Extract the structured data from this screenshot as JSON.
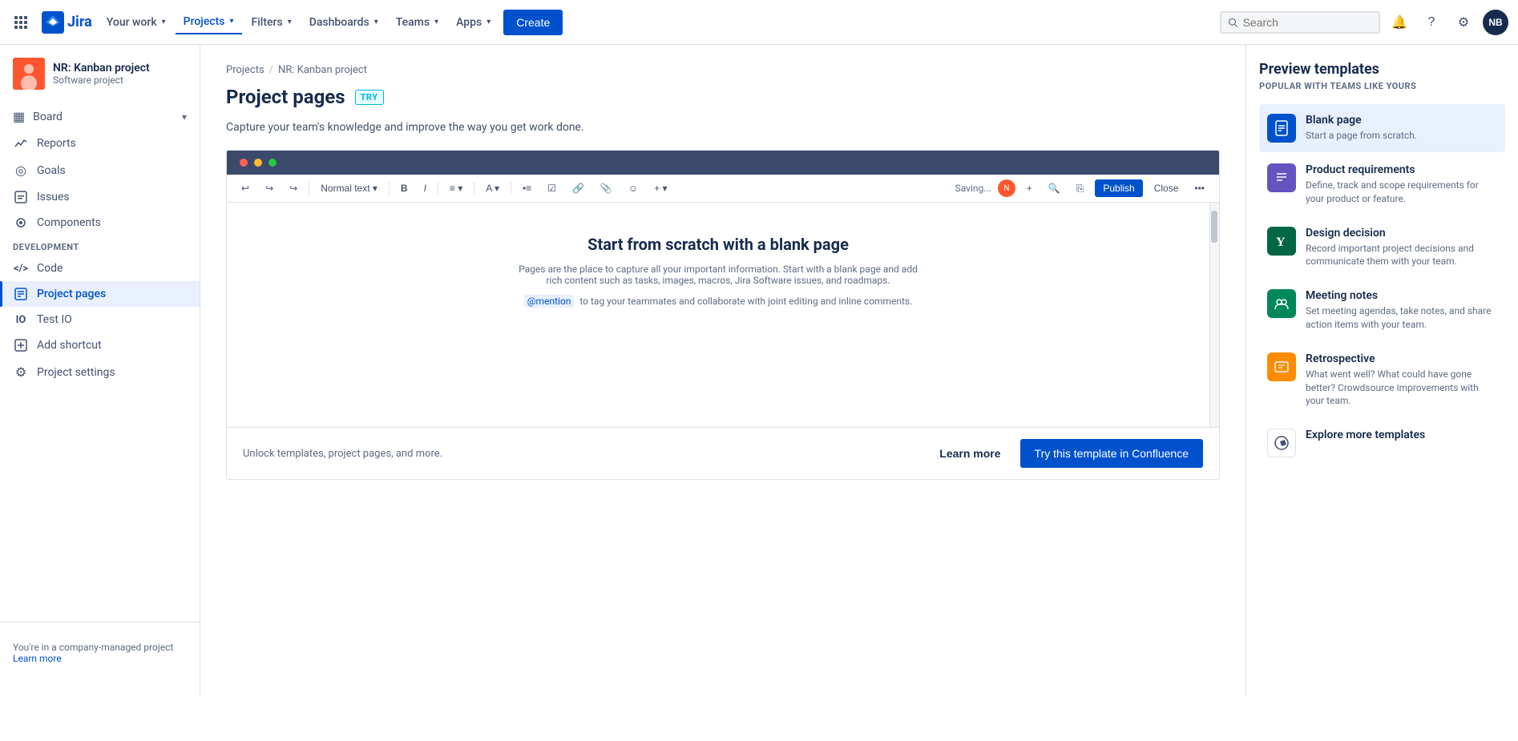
{
  "nav": {
    "your_work": "Your work",
    "projects": "Projects",
    "filters": "Filters",
    "dashboards": "Dashboards",
    "teams": "Teams",
    "apps": "Apps",
    "create": "Create",
    "search_placeholder": "Search",
    "avatar_initials": "NB"
  },
  "sidebar": {
    "project_name": "NR: Kanban project",
    "project_type": "Software project",
    "board_label": "Board",
    "items": [
      {
        "id": "reports",
        "label": "Reports",
        "icon": "📈"
      },
      {
        "id": "goals",
        "label": "Goals",
        "icon": "◎"
      },
      {
        "id": "issues",
        "label": "Issues",
        "icon": "▪"
      },
      {
        "id": "components",
        "label": "Components",
        "icon": "⊙"
      }
    ],
    "dev_section": "DEVELOPMENT",
    "dev_items": [
      {
        "id": "code",
        "label": "Code",
        "icon": "<>"
      }
    ],
    "project_pages_label": "Project pages",
    "test_io_label": "Test IO",
    "add_shortcut_label": "Add shortcut",
    "project_settings_label": "Project settings",
    "company_managed": "You're in a company-managed project",
    "learn_more": "Learn more"
  },
  "breadcrumb": {
    "projects": "Projects",
    "project_name": "NR: Kanban project"
  },
  "main": {
    "page_title": "Project pages",
    "try_badge": "TRY",
    "description": "Capture your team's knowledge and improve the way you get work done.",
    "editor": {
      "toolbar_items": [
        "Normal text",
        "B",
        "I",
        "≡",
        "A",
        "• ≡",
        "☑",
        "🔗",
        "📎",
        "☺",
        "+ ▾"
      ],
      "saving_text": "Saving...",
      "publish_btn": "Publish",
      "close_btn": "Close",
      "editor_title": "Start from scratch with a blank page",
      "editor_desc": "Pages are the place to capture all your important information. Start with a blank page and add rich content such as tasks, images, macros, Jira Software issues, and roadmaps.",
      "mention_label": "@mention",
      "mention_desc": "to tag your teammates and collaborate with joint editing and inline comments."
    },
    "bottom_bar": {
      "unlock_text": "Unlock templates, project pages, and more.",
      "learn_more": "Learn more",
      "try_confluence": "Try this template in Confluence"
    }
  },
  "right_panel": {
    "title": "Preview templates",
    "subtitle": "POPULAR WITH TEAMS LIKE YOURS",
    "templates": [
      {
        "id": "blank-page",
        "name": "Blank page",
        "desc": "Start a page from scratch.",
        "icon_char": "📄",
        "icon_class": "blue",
        "active": true
      },
      {
        "id": "product-requirements",
        "name": "Product requirements",
        "desc": "Define, track and scope requirements for your product or feature.",
        "icon_char": "≡",
        "icon_class": "purple",
        "active": false
      },
      {
        "id": "design-decision",
        "name": "Design decision",
        "desc": "Record important project decisions and communicate them with your team.",
        "icon_char": "Y",
        "icon_class": "green",
        "active": false
      },
      {
        "id": "meeting-notes",
        "name": "Meeting notes",
        "desc": "Set meeting agendas, take notes, and share action items with your team.",
        "icon_char": "👥",
        "icon_class": "teal",
        "active": false
      },
      {
        "id": "retrospective",
        "name": "Retrospective",
        "desc": "What went well? What could have gone better? Crowdsource improvements with your team.",
        "icon_char": "💬",
        "icon_class": "yellow",
        "active": false
      },
      {
        "id": "explore",
        "name": "Explore more templates",
        "desc": "",
        "icon_char": "🧭",
        "icon_class": "explore",
        "active": false
      }
    ]
  }
}
